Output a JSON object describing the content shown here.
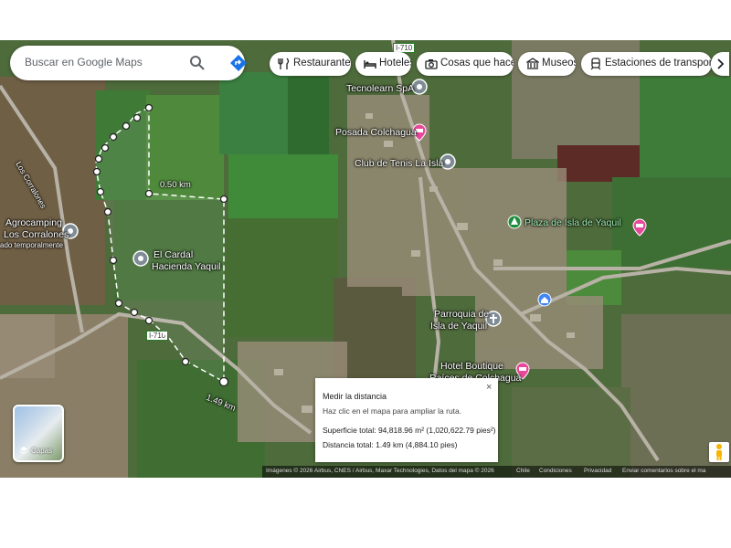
{
  "search": {
    "placeholder": "Buscar en Google Maps"
  },
  "chips": [
    {
      "label": "Restaurantes",
      "icon": "fork-knife-icon"
    },
    {
      "label": "Hoteles",
      "icon": "bed-icon"
    },
    {
      "label": "Cosas que hacer",
      "icon": "camera-icon"
    },
    {
      "label": "Museos",
      "icon": "museum-icon"
    },
    {
      "label": "Estaciones de transport...",
      "icon": "train-icon"
    }
  ],
  "road_labels": {
    "i710_top": "I-710",
    "i710_mid": "I-710",
    "los_corralones": "Los Corralones"
  },
  "places": {
    "tecnolearn": "Tecnolearn SpA",
    "posada": "Posada Colchagua",
    "club": "Club de Tenis La Isla",
    "plaza": "Plaza de Isla de Yaquil",
    "agrocamping_1": "Agrocamping",
    "agrocamping_2": "Los Corralones",
    "agrocamping_3": "ado temporalmente",
    "cardal_1": "El Cardal",
    "cardal_2": "Hacienda Yaquil",
    "parroquia_1": "Parroquia de",
    "parroquia_2": "Isla de Yaquil",
    "hotel_1": "Hotel Boutique",
    "hotel_2": "Raíces de Colchagua"
  },
  "measure_labels": {
    "segment": "0.50 km",
    "total": "1.49 km"
  },
  "route_box": {
    "title": "Medir la distancia",
    "hint": "Haz clic en el mapa para ampliar la ruta.",
    "area": "Superficie total: 94,818.96 m² (1,020,622.79 pies²)",
    "distance": "Distancia total: 1.49 km (4,884.10 pies)",
    "close": "×"
  },
  "layers": {
    "label": "Capas"
  },
  "footer": {
    "credits": "Imágenes © 2026 Airbus, CNES / Airbus, Maxar Technologies, Datos del mapa © 2026",
    "country": "Chile",
    "terms": "Condiciones",
    "privacy": "Privacidad",
    "feedback": "Enviar comentarios sobre el ma"
  },
  "colors": {
    "route": "#ffffff",
    "hotel_pin": "#e8489a",
    "poi_pin": "#7f8c96",
    "church_pin": "#4285f4",
    "plaza_text": "#9ff0b4"
  }
}
